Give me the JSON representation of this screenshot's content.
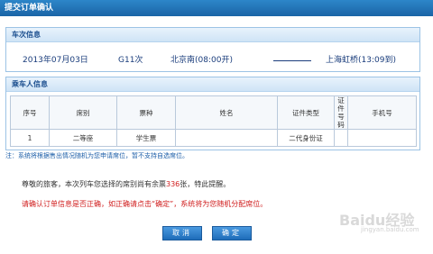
{
  "title": "提交订单确认",
  "train_info": {
    "header": "车次信息",
    "date": "2013年07月03日",
    "train_no": "G11次",
    "from": "北京南(08:00开)",
    "to": "上海虹桥(13:09到)"
  },
  "passenger_info": {
    "header": "乘车人信息",
    "columns": [
      "序号",
      "席别",
      "票种",
      "姓名",
      "证件类型",
      "证件号码",
      "手机号"
    ],
    "rows": [
      {
        "index": "1",
        "seat": "二等座",
        "ticket_type": "学生票",
        "name": "",
        "id_type": "二代身份证",
        "id_no": "",
        "phone": ""
      }
    ]
  },
  "note": "注：系统将根据售出情况随机为您申请席位，暂不支持自选席位。",
  "message1": {
    "prefix": "尊敬的旅客，本次列车您选择的席别尚有余票",
    "count": "336",
    "suffix": "张，特此提醒。"
  },
  "message2": "请确认订单信息是否正确，如正确请点击“确定”，系统将为您随机分配席位。",
  "buttons": {
    "cancel": "取消",
    "confirm": "确定"
  },
  "watermark": {
    "logo": "Baidu经验",
    "url": "jingyan.baidu.com"
  }
}
